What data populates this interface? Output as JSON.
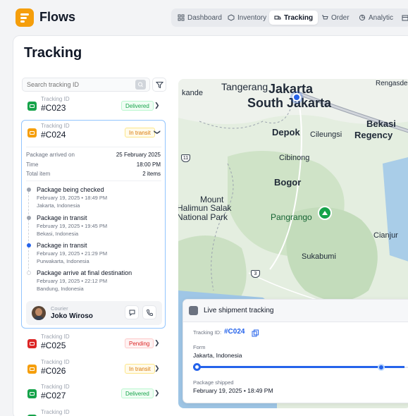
{
  "app": {
    "name": "Flows"
  },
  "nav": [
    {
      "label": "Dashboard",
      "icon": "grid-icon"
    },
    {
      "label": "Inventory",
      "icon": "box-icon"
    },
    {
      "label": "Tracking",
      "icon": "truck-icon",
      "active": true
    },
    {
      "label": "Order",
      "icon": "cart-icon"
    },
    {
      "label": "Analytic",
      "icon": "pie-icon"
    }
  ],
  "page": {
    "title": "Tracking"
  },
  "search": {
    "placeholder": "Search tracking ID"
  },
  "list_label": "Tracking ID",
  "shipments": [
    {
      "id": "#C023",
      "status": "Delivered"
    },
    {
      "id": "#C024",
      "status": "In transit"
    },
    {
      "id": "#C025",
      "status": "Pending"
    },
    {
      "id": "#C026",
      "status": "In transit"
    },
    {
      "id": "#C027",
      "status": "Delivered"
    }
  ],
  "details": {
    "arrived_label": "Package arrived on",
    "arrived_value": "25 February 2025",
    "time_label": "Time",
    "time_value": "18:00 PM",
    "total_label": "Total item",
    "total_value": "2 items"
  },
  "timeline": [
    {
      "title": "Package being checked",
      "date": "February 19, 2025 • 18:49 PM",
      "place": "Jakarta, Indonesia"
    },
    {
      "title": "Package in transit",
      "date": "February 19, 2025 • 19:45 PM",
      "place": "Bekasi, Indonesia"
    },
    {
      "title": "Package in transit",
      "date": "February 19, 2025 • 21:29 PM",
      "place": "Purwakarta, Indonesia"
    },
    {
      "title": "Package arrive at final destination",
      "date": "February 19, 2025 • 22:12 PM",
      "place": "Bandung, Indonesia"
    }
  ],
  "courier": {
    "label": "Courier",
    "name": "Joko Wiroso"
  },
  "map": {
    "labels": [
      "Tangerang",
      "Jakarta",
      "South Jakarta",
      "Rengasdengklok",
      "kande",
      "Depok",
      "Cileungsi",
      "Bekasi",
      "Regency",
      "Cibinong",
      "Bogor",
      "Mount",
      "Halimun Salak",
      "National Park",
      "Pangrango",
      "Cianjur",
      "Sukabumi"
    ],
    "road_badges": [
      "11",
      "3"
    ]
  },
  "live": {
    "title": "Live shipment tracking",
    "tracking_label": "Tracking ID:",
    "tracking_value": "#C024",
    "from_label": "Form",
    "from_value": "Jakarta, Indonesia",
    "shipped_label": "Package shipped",
    "shipped_value": "February 19, 2025 • 18:49 PM"
  },
  "colors": {
    "delivered": "#16a34a",
    "in_transit": "#f59e0b",
    "pending": "#dc2626",
    "accent": "#2563eb"
  }
}
